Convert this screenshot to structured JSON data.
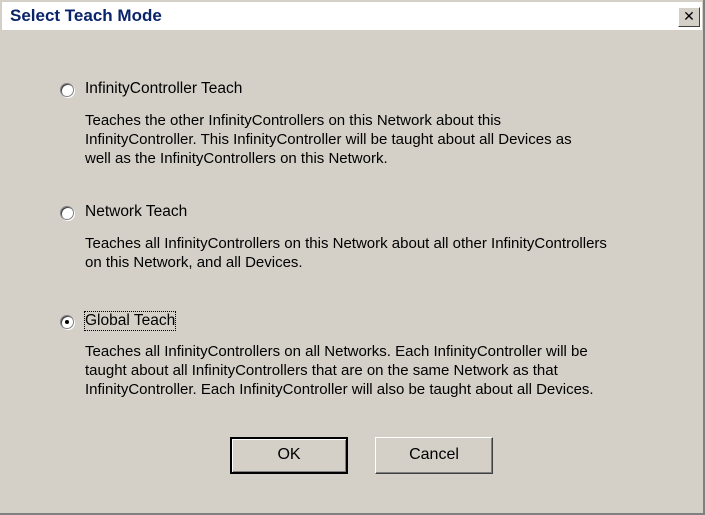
{
  "window": {
    "title": "Select Teach Mode",
    "close_glyph": "✕"
  },
  "options": [
    {
      "label": "InfinityController Teach",
      "description_lines": [
        "Teaches the other InfinityControllers on this Network about this",
        "InfinityController. This InfinityController will be taught about all Devices as",
        "well as the InfinityControllers on this Network."
      ],
      "selected": false
    },
    {
      "label": "Network Teach",
      "description_lines": [
        "Teaches all InfinityControllers on this Network about all other InfinityControllers",
        "on this Network, and all Devices."
      ],
      "selected": false
    },
    {
      "label": "Global Teach",
      "description_lines": [
        "Teaches all InfinityControllers on all Networks. Each InfinityController will be",
        "taught about all InfinityControllers that are on the same Network as that",
        "InfinityController. Each InfinityController will also be taught about all Devices."
      ],
      "selected": true
    }
  ],
  "buttons": {
    "ok_label": "OK",
    "cancel_label": "Cancel"
  },
  "colors": {
    "dialog_bg": "#d4d0c8",
    "title_text": "#0a246a",
    "titlebar_bg": "#ffffff"
  }
}
